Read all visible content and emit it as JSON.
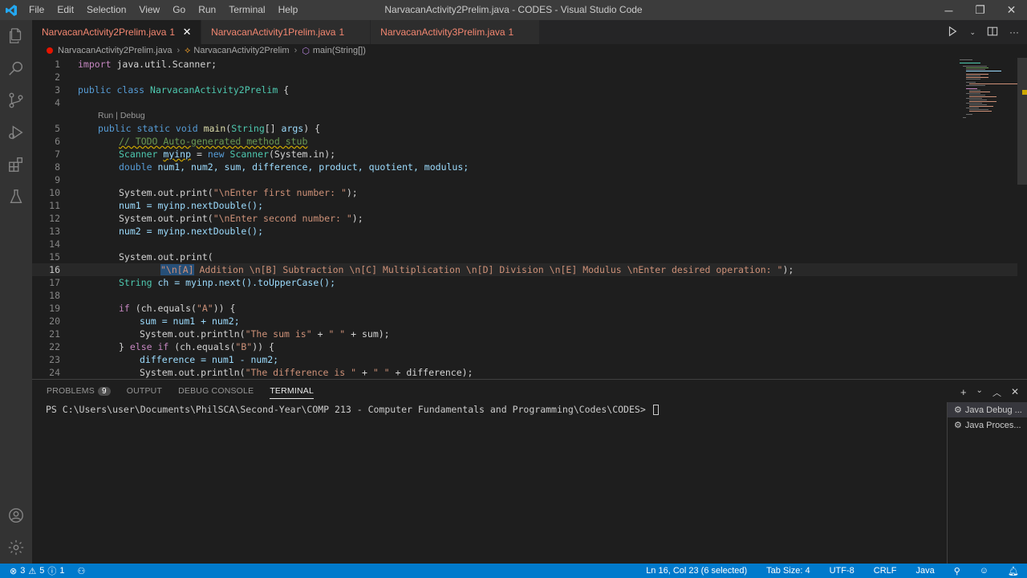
{
  "window": {
    "title": "NarvacanActivity2Prelim.java - CODES - Visual Studio Code",
    "menu": [
      "File",
      "Edit",
      "Selection",
      "View",
      "Go",
      "Run",
      "Terminal",
      "Help"
    ],
    "controls": {
      "minimize": "─",
      "maximize": "❐",
      "close": "✕"
    }
  },
  "tabs": [
    {
      "label": "NarvacanActivity2Prelim.java",
      "count": "1",
      "active": true
    },
    {
      "label": "NarvacanActivity1Prelim.java",
      "count": "1",
      "active": false
    },
    {
      "label": "NarvacanActivity3Prelim.java",
      "count": "1",
      "active": false
    }
  ],
  "breadcrumb": {
    "file": "NarvacanActivity2Prelim.java",
    "class": "NarvacanActivity2Prelim",
    "method": "main(String[])"
  },
  "codelens": "Run | Debug",
  "line_numbers": [
    "1",
    "2",
    "3",
    "4",
    "5",
    "6",
    "7",
    "8",
    "9",
    "10",
    "11",
    "12",
    "13",
    "14",
    "15",
    "16",
    "17",
    "18",
    "19",
    "20",
    "21",
    "22",
    "23",
    "24"
  ],
  "code": {
    "l1_import": "import",
    "l1_pkg": " java.util.Scanner;",
    "l3_public": "public",
    "l3_class": " class ",
    "l3_name": "NarvacanActivity2Prelim",
    "l3_brace": " {",
    "l5_a": "public static void",
    "l5_main": "main",
    "l5_b": "(",
    "l5_string": "String",
    "l5_c": "[] ",
    "l5_args": "args",
    "l5_d": ") {",
    "l6": "// TODO Auto-generated method stub",
    "l7_type": "Scanner",
    "l7_var": "myinp",
    "l7_eq": " = ",
    "l7_new": "new",
    "l7_type2": "Scanner",
    "l7_arg": "(System.in);",
    "l8_double": "double",
    "l8_vars": " num1, num2, sum, difference, product, quotient, modulus;",
    "l10_pre": "System.out.print(",
    "l10_str": "\"\\nEnter first number: \"",
    "l10_post": ");",
    "l11": "num1 = myinp.nextDouble();",
    "l12_pre": "System.out.print(",
    "l12_str": "\"\\nEnter second number: \"",
    "l12_post": ");",
    "l13": "num2 = myinp.nextDouble();",
    "l15": "System.out.print(",
    "l16_sel": "\"\\n[A]",
    "l16_rest": " Addition \\n[B] Subtraction \\n[C] Multiplication \\n[D] Division \\n[E] Modulus \\nEnter desired operation: \"",
    "l16_end": ");",
    "l17_type": "String",
    "l17_rest": " ch = myinp.next().toUpperCase();",
    "l19_if": "if",
    "l19_a": " (ch.equals(",
    "l19_str": "\"A\"",
    "l19_b": ")) {",
    "l20": "sum = num1 + num2;",
    "l21_pre": "System.out.println(",
    "l21_str": "\"The sum is\"",
    "l21_mid": " + ",
    "l21_str2": "\" \"",
    "l21_post": " + sum);",
    "l22_a": "} ",
    "l22_else": "else if",
    "l22_b": " (ch.equals(",
    "l22_str": "\"B\"",
    "l22_c": ")) {",
    "l23": "difference = num1 - num2;",
    "l24_pre": "System.out.println(",
    "l24_str": "\"The difference is \"",
    "l24_mid": " + ",
    "l24_str2": "\" \"",
    "l24_post": " + difference);"
  },
  "panel": {
    "tabs": [
      {
        "label": "PROBLEMS",
        "badge": "9"
      },
      {
        "label": "OUTPUT"
      },
      {
        "label": "DEBUG CONSOLE"
      },
      {
        "label": "TERMINAL",
        "active": true
      }
    ],
    "terminal_prompt": "PS C:\\Users\\user\\Documents\\PhilSCA\\Second-Year\\COMP 213 - Computer Fundamentals and Programming\\Codes\\CODES>",
    "terminals": [
      "Java Debug ...",
      "Java Proces..."
    ]
  },
  "statusbar": {
    "errors": "3",
    "warnings": "5",
    "info": "1",
    "cursor": "Ln 16, Col 23 (6 selected)",
    "tab_size": "Tab Size: 4",
    "encoding": "UTF-8",
    "eol": "CRLF",
    "language": "Java"
  },
  "colors": {
    "accent": "#007acc",
    "error": "#e51400",
    "tab_error_text": "#f48771"
  }
}
